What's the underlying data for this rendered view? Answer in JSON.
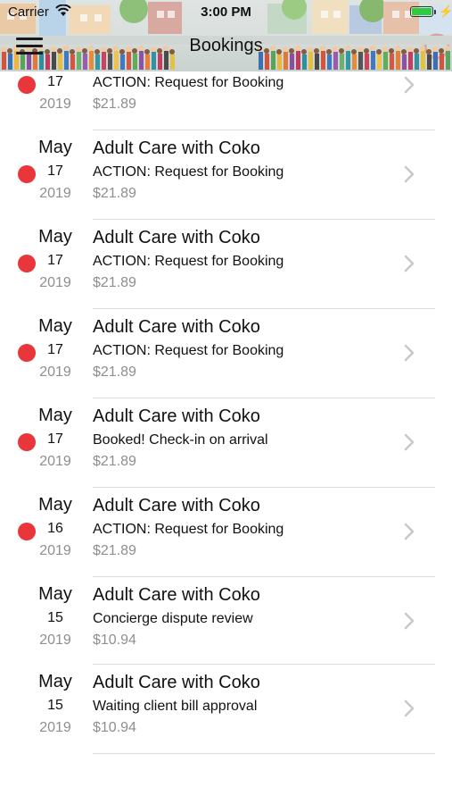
{
  "status_bar": {
    "carrier": "Carrier",
    "time": "3:00 PM"
  },
  "nav": {
    "title": "Bookings"
  },
  "colors": {
    "unread_dot": "#e8363a",
    "secondary_text": "#8e8e93"
  },
  "bookings": [
    {
      "month": "",
      "day": "17",
      "year": "2019",
      "title": "",
      "status": "ACTION: Request for Booking",
      "price": "$21.89",
      "unread": true
    },
    {
      "month": "May",
      "day": "17",
      "year": "2019",
      "title": "Adult Care with Coko",
      "status": "ACTION: Request for Booking",
      "price": "$21.89",
      "unread": true
    },
    {
      "month": "May",
      "day": "17",
      "year": "2019",
      "title": "Adult Care with Coko",
      "status": "ACTION: Request for Booking",
      "price": "$21.89",
      "unread": true
    },
    {
      "month": "May",
      "day": "17",
      "year": "2019",
      "title": "Adult Care with Coko",
      "status": "ACTION: Request for Booking",
      "price": "$21.89",
      "unread": true
    },
    {
      "month": "May",
      "day": "17",
      "year": "2019",
      "title": "Adult Care with Coko",
      "status": "Booked! Check-in on arrival",
      "price": "$21.89",
      "unread": true
    },
    {
      "month": "May",
      "day": "16",
      "year": "2019",
      "title": "Adult Care with Coko",
      "status": "ACTION: Request for Booking",
      "price": "$21.89",
      "unread": true
    },
    {
      "month": "May",
      "day": "15",
      "year": "2019",
      "title": "Adult Care with Coko",
      "status": "Concierge dispute review",
      "price": "$10.94",
      "unread": false
    },
    {
      "month": "May",
      "day": "15",
      "year": "2019",
      "title": "Adult Care with Coko",
      "status": "Waiting client bill approval",
      "price": "$10.94",
      "unread": false
    }
  ]
}
